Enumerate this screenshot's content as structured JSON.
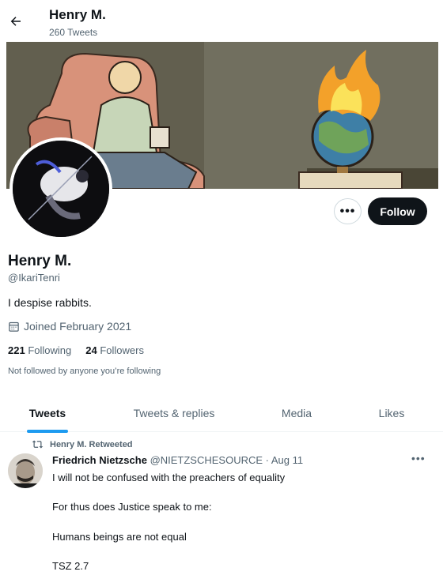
{
  "header": {
    "name": "Henry M.",
    "tweet_count": "260 Tweets"
  },
  "profile": {
    "name": "Henry M.",
    "handle": "@IkariTenri",
    "bio": "I despise rabbits.",
    "joined": "Joined February 2021",
    "following_count": "221",
    "following_label": "Following",
    "followers_count": "24",
    "followers_label": "Followers",
    "not_followed": "Not followed by anyone you’re following",
    "follow_label": "Follow",
    "more_label": "•••"
  },
  "tabs": [
    {
      "label": "Tweets"
    },
    {
      "label": "Tweets & replies"
    },
    {
      "label": "Media"
    },
    {
      "label": "Likes"
    }
  ],
  "tweet": {
    "retweeted_by": "Henry M. Retweeted",
    "author": "Friedrich Nietzsche",
    "handle_date": "@NIETZSCHESOURCE · Aug 11",
    "lines": [
      "I will not be confused with the preachers of equality",
      "For thus does Justice speak to me:",
      "Humans beings are not equal",
      "TSZ 2.7"
    ],
    "more_label": "•••"
  },
  "colors": {
    "accent": "#1d9bf0",
    "text": "#0f1419",
    "muted": "#536471",
    "follow_bg": "#0f1419"
  },
  "icons": {
    "back": "arrow-left-icon",
    "calendar": "calendar-icon",
    "retweet": "retweet-icon",
    "more": "more-dots-icon"
  }
}
